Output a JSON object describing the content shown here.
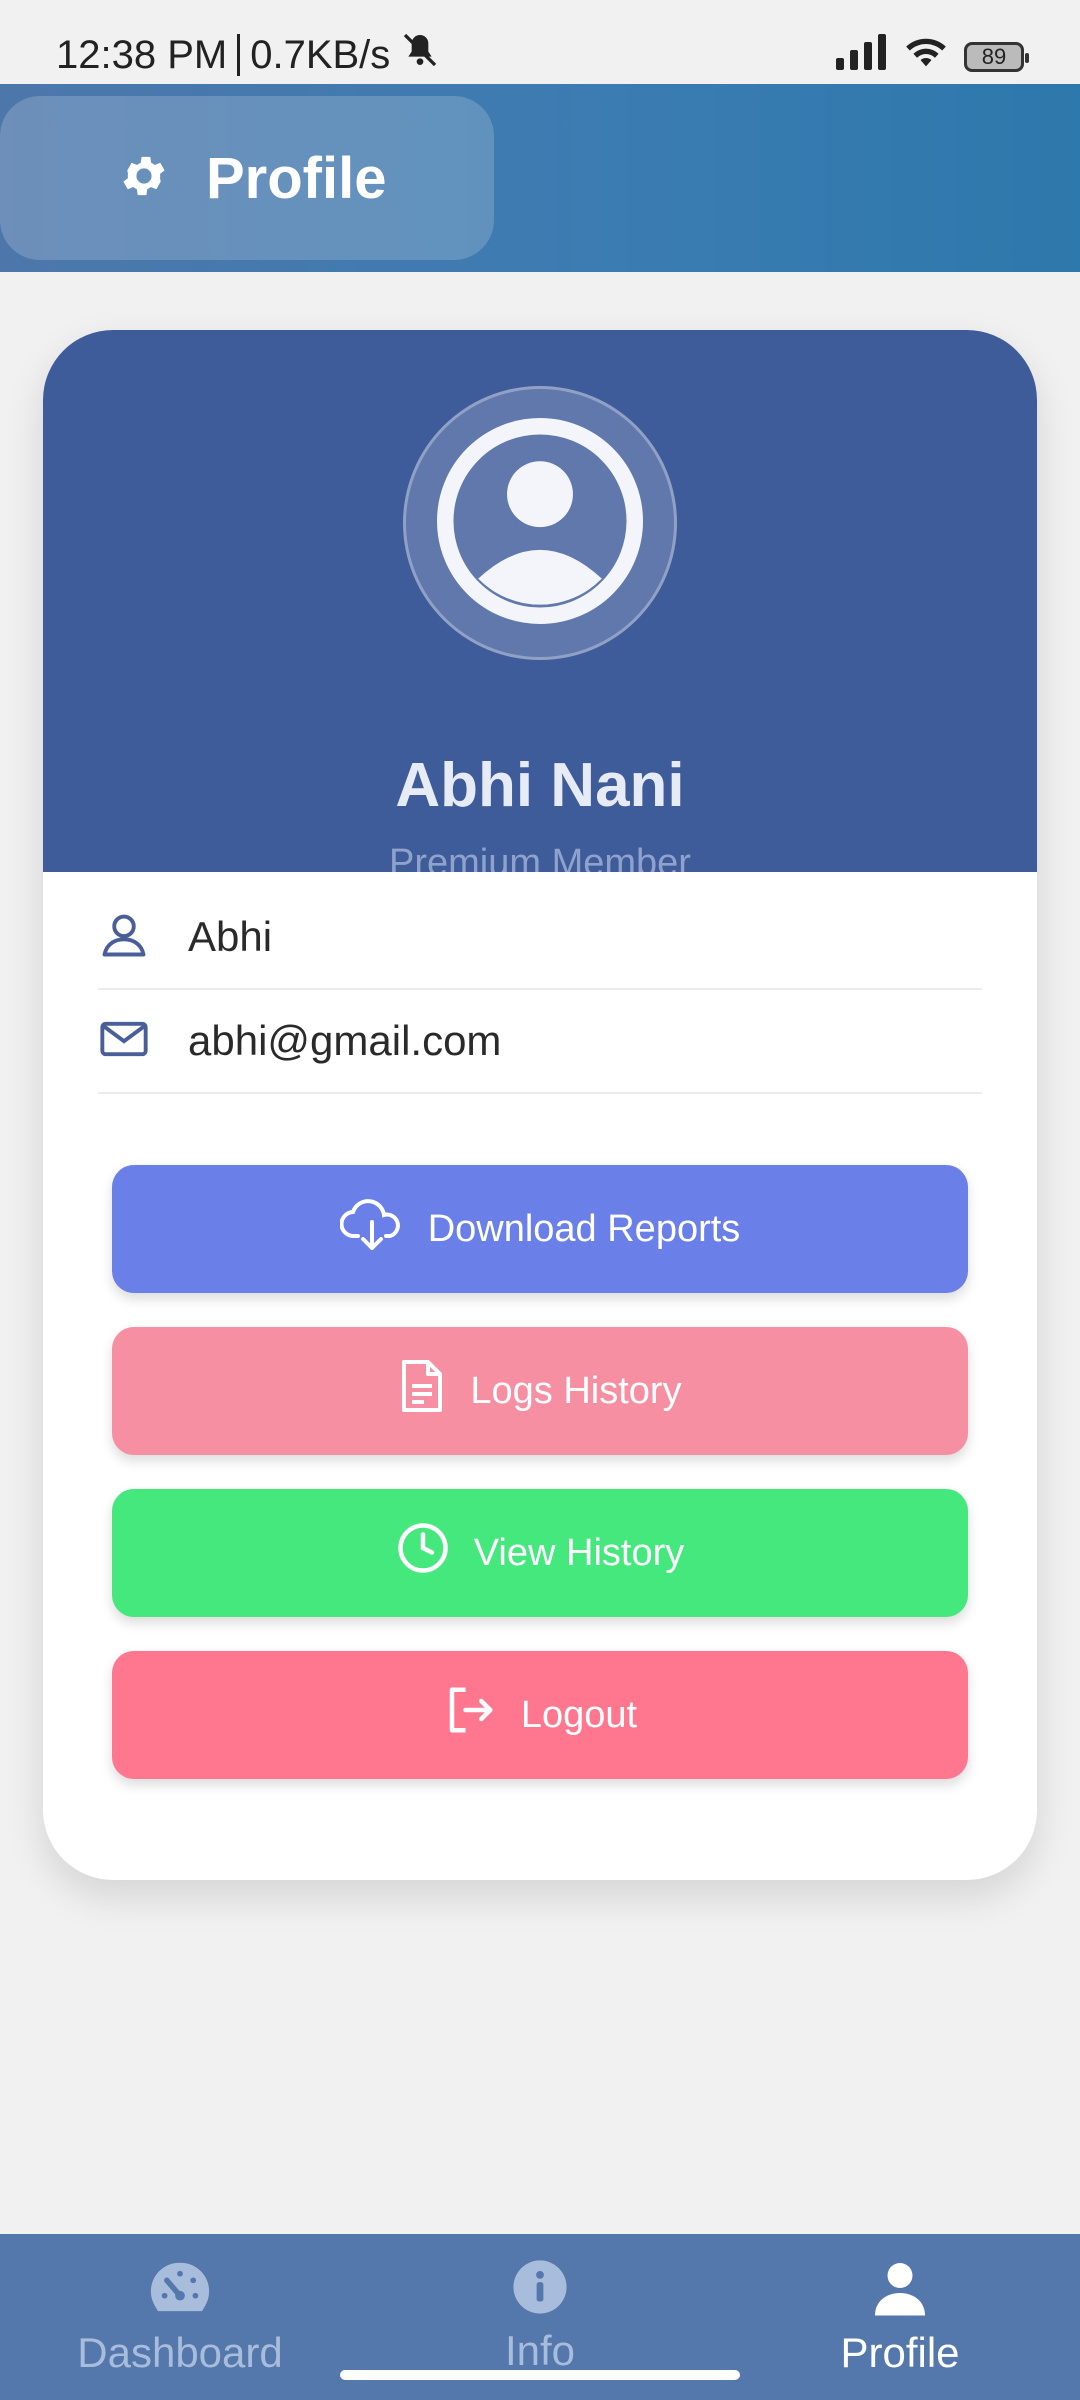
{
  "status_bar": {
    "time": "12:38 PM",
    "network_speed": "0.7KB/s",
    "battery_level": "89",
    "icons": [
      "muted-bell-icon",
      "cellular-signal-icon",
      "wifi-icon",
      "battery-icon"
    ]
  },
  "header": {
    "icon": "gear-icon",
    "title": "Profile"
  },
  "profile": {
    "avatar_icon": "user-circle-icon",
    "name": "Abhi Nani",
    "subtitle": "Premium Member"
  },
  "info": {
    "username": "Abhi",
    "email": "abhi@gmail.com"
  },
  "actions": [
    {
      "label": "Download Reports",
      "icon": "cloud-download-icon",
      "color": "#6a7fe8"
    },
    {
      "label": "Logs History",
      "icon": "document-icon",
      "color": "#f78fa2"
    },
    {
      "label": "View History",
      "icon": "clock-icon",
      "color": "#45e87c"
    },
    {
      "label": "Logout",
      "icon": "logout-icon",
      "color": "#ff778f"
    }
  ],
  "bottom_nav": {
    "items": [
      {
        "label": "Dashboard",
        "icon": "speedometer-icon",
        "active": false
      },
      {
        "label": "Info",
        "icon": "info-icon",
        "active": false
      },
      {
        "label": "Profile",
        "icon": "person-icon",
        "active": true
      }
    ]
  },
  "colors": {
    "header_gradient_start": "#4d77ab",
    "header_gradient_end": "#2d78ac",
    "card_top": "#3e5b9a",
    "nav_background": "#5477ac",
    "page_background": "#f1f1f2"
  }
}
